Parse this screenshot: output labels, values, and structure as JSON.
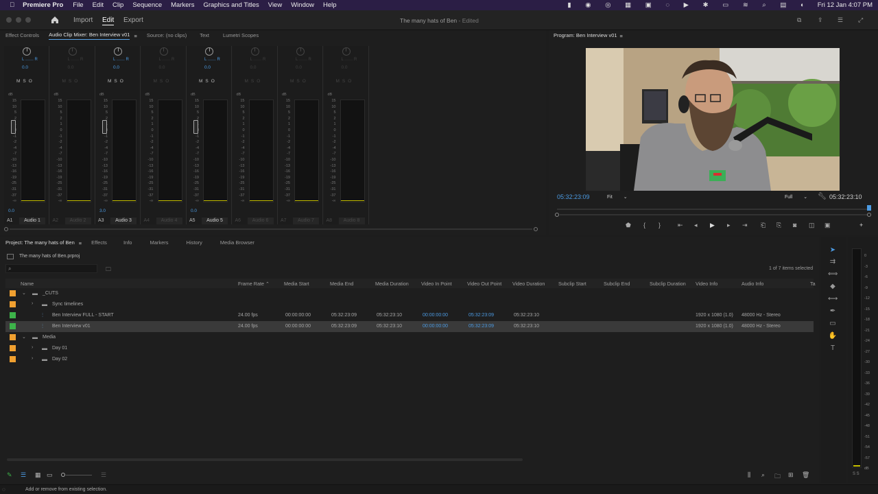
{
  "menubar": {
    "apple": "",
    "app": "Premiere Pro",
    "items": [
      "File",
      "Edit",
      "Clip",
      "Sequence",
      "Markers",
      "Graphics and Titles",
      "View",
      "Window",
      "Help"
    ],
    "clock": "Fri 12 Jan  4:07 PM"
  },
  "titlebar": {
    "workspaces": [
      "Import",
      "Edit",
      "Export"
    ],
    "active_workspace": "Edit",
    "doc_title": "The many hats of Ben",
    "doc_status": "- Edited"
  },
  "mixer_panel": {
    "tabs": [
      "Effect Controls",
      "Audio Clip Mixer: Ben Interview v01",
      "Source: (no clips)",
      "Text",
      "Lumetri Scopes"
    ],
    "active_tab": "Audio Clip Mixer: Ben Interview v01",
    "lr_label": "L",
    "lr_label_r": "R",
    "pan_value": "0.0",
    "mso": "MSO",
    "db_label": "dB",
    "scale_ticks": [
      "15",
      "10",
      "5",
      "2",
      "1",
      "0",
      "-1",
      "-2",
      "-4",
      "-7",
      "-10",
      "-13",
      "-16",
      "-19",
      "-25",
      "-31",
      "-37",
      "-∞"
    ],
    "tracks": [
      {
        "id": "A1",
        "name": "Audio 1",
        "active": true,
        "fader_value": "0.0"
      },
      {
        "id": "A2",
        "name": "Audio 2",
        "active": false,
        "fader_value": ""
      },
      {
        "id": "A3",
        "name": "Audio 3",
        "active": true,
        "fader_value": "3.0"
      },
      {
        "id": "A4",
        "name": "Audio 4",
        "active": false,
        "fader_value": ""
      },
      {
        "id": "A5",
        "name": "Audio 5",
        "active": true,
        "fader_value": "0.0"
      },
      {
        "id": "A6",
        "name": "Audio 6",
        "active": false,
        "fader_value": ""
      },
      {
        "id": "A7",
        "name": "Audio 7",
        "active": false,
        "fader_value": ""
      },
      {
        "id": "A8",
        "name": "Audio 8",
        "active": false,
        "fader_value": ""
      }
    ]
  },
  "program_monitor": {
    "title": "Program: Ben Interview v01",
    "current_time": "05:32:23:09",
    "zoom": "Fit",
    "quality": "Full",
    "duration": "05:32:23:10"
  },
  "project_panel": {
    "tabs": [
      "Project: The many hats of Ben",
      "Effects",
      "Info",
      "Markers",
      "History",
      "Media Browser"
    ],
    "active_tab": "Project: The many hats of Ben",
    "project_file": "The many hats of Ben.prproj",
    "selection_count": "1 of 7 items selected",
    "search_placeholder": "",
    "columns": [
      "Name",
      "Frame Rate",
      "Media Start",
      "Media End",
      "Media Duration",
      "Video In Point",
      "Video Out Point",
      "Video Duration",
      "Subclip Start",
      "Subclip End",
      "Subclip Duration",
      "Video Info",
      "Audio Info",
      "Ta"
    ],
    "rows": [
      {
        "name": "_CUTS",
        "type": "folder",
        "color": "#f0a030",
        "indent": 0,
        "expanded": true,
        "selected": false,
        "frame_rate": "",
        "media_start": "",
        "media_end": "",
        "media_duration": "",
        "in": "",
        "out": "",
        "video_duration": "",
        "video_info": "",
        "audio_info": ""
      },
      {
        "name": "Sync timelines",
        "type": "folder",
        "color": "#f0a030",
        "indent": 1,
        "expanded": false,
        "selected": false,
        "frame_rate": "",
        "media_start": "",
        "media_end": "",
        "media_duration": "",
        "in": "",
        "out": "",
        "video_duration": "",
        "video_info": "",
        "audio_info": ""
      },
      {
        "name": "Ben Interview FULL - START",
        "type": "sequence",
        "color": "#3db34a",
        "indent": 1,
        "expanded": false,
        "selected": false,
        "frame_rate": "24.00 fps",
        "media_start": "00:00:00:00",
        "media_end": "05:32:23:09",
        "media_duration": "05:32:23:10",
        "in": "00:00:00:00",
        "out": "05:32:23:09",
        "video_duration": "05:32:23:10",
        "video_info": "1920 x 1080 (1.0)",
        "audio_info": "48000 Hz - Stereo"
      },
      {
        "name": "Ben Interview v01",
        "type": "sequence",
        "color": "#3db34a",
        "indent": 1,
        "expanded": false,
        "selected": true,
        "frame_rate": "24.00 fps",
        "media_start": "00:00:00:00",
        "media_end": "05:32:23:09",
        "media_duration": "05:32:23:10",
        "in": "00:00:00:00",
        "out": "05:32:23:09",
        "video_duration": "05:32:23:10",
        "video_info": "1920 x 1080 (1.0)",
        "audio_info": "48000 Hz - Stereo"
      },
      {
        "name": "Media",
        "type": "folder",
        "color": "#f0a030",
        "indent": 0,
        "expanded": true,
        "selected": false,
        "frame_rate": "",
        "media_start": "",
        "media_end": "",
        "media_duration": "",
        "in": "",
        "out": "",
        "video_duration": "",
        "video_info": "",
        "audio_info": ""
      },
      {
        "name": "Day 01",
        "type": "folder",
        "color": "#f0a030",
        "indent": 1,
        "expanded": false,
        "selected": false,
        "frame_rate": "",
        "media_start": "",
        "media_end": "",
        "media_duration": "",
        "in": "",
        "out": "",
        "video_duration": "",
        "video_info": "",
        "audio_info": ""
      },
      {
        "name": "Day 02",
        "type": "folder",
        "color": "#f0a030",
        "indent": 1,
        "expanded": false,
        "selected": false,
        "frame_rate": "",
        "media_start": "",
        "media_end": "",
        "media_duration": "",
        "in": "",
        "out": "",
        "video_duration": "",
        "video_info": "",
        "audio_info": ""
      }
    ]
  },
  "audio_meter": {
    "scale": [
      "0",
      "-3",
      "-6",
      "-9",
      "-12",
      "-15",
      "-18",
      "-21",
      "-24",
      "-27",
      "-30",
      "-33",
      "-36",
      "-39",
      "-42",
      "-45",
      "-48",
      "-51",
      "-54",
      "-57",
      "dB"
    ],
    "solo_labels": "S S"
  },
  "status_bar": {
    "message": "Add or remove from existing selection."
  },
  "colors": {
    "accent_blue": "#4c9be3",
    "menubar_bg": "#2b1e45",
    "folder_orange": "#f0a030",
    "sequence_green": "#3db34a",
    "meter_yellow": "#c9c200"
  },
  "icons": {
    "home": "home-icon",
    "search": "search-icon",
    "wrench": "wrench-icon",
    "play": "play-icon"
  }
}
